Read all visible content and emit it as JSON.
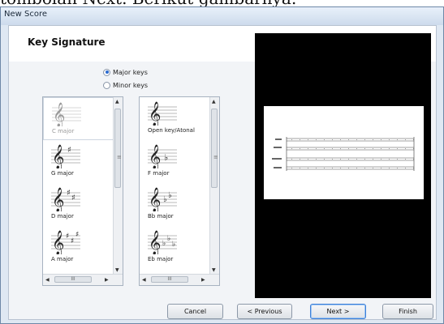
{
  "background_text": "tombolan Next. Berikut gambarnya:",
  "window": {
    "title": "New Score"
  },
  "page": {
    "heading": "Key Signature"
  },
  "key_mode": {
    "options": [
      {
        "label": "Major keys",
        "selected": true
      },
      {
        "label": "Minor keys",
        "selected": false
      }
    ]
  },
  "list_left": {
    "items": [
      {
        "label": "C major",
        "icon": "treble-clef-icon",
        "selected": true
      },
      {
        "label": "G major",
        "icon": "treble-clef-1-sharp-icon",
        "selected": false
      },
      {
        "label": "D major",
        "icon": "treble-clef-2-sharps-icon",
        "selected": false
      },
      {
        "label": "A major",
        "icon": "treble-clef-3-sharps-icon",
        "selected": false
      }
    ]
  },
  "list_right": {
    "items": [
      {
        "label": "Open key/Atonal",
        "icon": "treble-clef-icon"
      },
      {
        "label": "F major",
        "icon": "treble-clef-1-flat-icon"
      },
      {
        "label": "Bb major",
        "icon": "treble-clef-2-flats-icon"
      },
      {
        "label": "Eb major",
        "icon": "treble-clef-3-flats-icon"
      }
    ]
  },
  "scroll": {
    "grip": "≡",
    "hgrip": "III"
  },
  "buttons": {
    "cancel": "Cancel",
    "previous": "< Previous",
    "next": "Next >",
    "finish": "Finish"
  },
  "colors": {
    "preview_bg": "#000000",
    "accent": "#3c7fd8"
  }
}
